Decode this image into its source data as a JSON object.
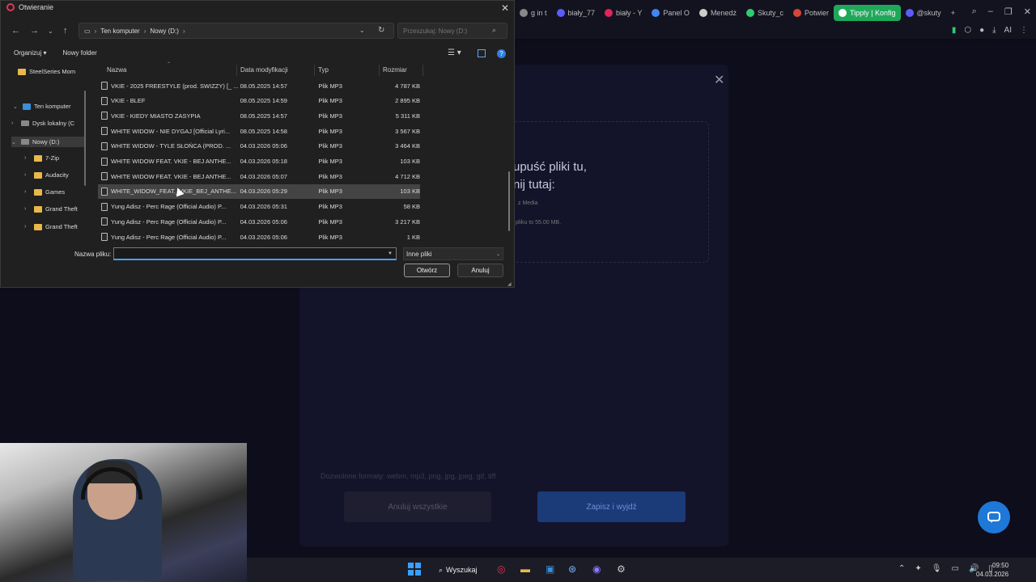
{
  "browser": {
    "tabs": [
      {
        "label": "g in t",
        "color": "#888888"
      },
      {
        "label": "biały_77",
        "color": "#5c5cff"
      },
      {
        "label": "biały - Y",
        "color": "#e0245e"
      },
      {
        "label": "Panel O",
        "color": "#4285f4"
      },
      {
        "label": "Menedż",
        "color": "#cccccc"
      },
      {
        "label": "Skuty_c",
        "color": "#2ecc71"
      },
      {
        "label": "Potwier",
        "color": "#d44638"
      },
      {
        "label": "Tipply | Konfig",
        "color": "#ffffff"
      },
      {
        "label": "@skuty",
        "color": "#5c5cff"
      }
    ],
    "active_tab_index": 7,
    "new_tab": "+",
    "ext_label": "AI"
  },
  "background_page": {
    "drop_text": "upuść pliki tu,\nnij tutaj:",
    "drop_sub": "z Media",
    "drop_size": "pliku to 55.00 MB.",
    "allowed_formats": "Dozwolone formaty: webm, mp3, png, jpg, jpeg, gif, tiff",
    "cancel_all_label": "Anuluj wszystkie",
    "save_label": "Zapisz i wyjdź"
  },
  "taskbar": {
    "search_label": "Wyszukaj",
    "time": "09:50",
    "date": "04.03.2026"
  },
  "dialog": {
    "title": "Otwieranie",
    "address": {
      "root": "Ten komputer",
      "current": "Nowy (D:)"
    },
    "search_placeholder": "Przeszukaj: Nowy (D:)",
    "toolbar": {
      "organize": "Organizuj",
      "new_folder": "Nowy folder"
    },
    "nav": [
      {
        "label": "SteelSeries Mom",
        "icon": "folder-icon",
        "level": 0
      },
      {
        "label": "Ten komputer",
        "icon": "pc-icon",
        "level": 0
      },
      {
        "label": "Dysk lokalny (C",
        "icon": "drive-icon",
        "level": 1
      },
      {
        "label": "Nowy (D:)",
        "icon": "drive-icon",
        "level": 1
      },
      {
        "label": "7-Zip",
        "icon": "folder-icon",
        "level": 2
      },
      {
        "label": "Audacity",
        "icon": "folder-icon",
        "level": 2
      },
      {
        "label": "Games",
        "icon": "folder-icon",
        "level": 2
      },
      {
        "label": "Grand Theft",
        "icon": "folder-icon",
        "level": 2
      },
      {
        "label": "Grand Theft",
        "icon": "folder-icon",
        "level": 2
      }
    ],
    "columns": {
      "name": "Nazwa",
      "date": "Data modyfikacji",
      "type": "Typ",
      "size": "Rozmiar"
    },
    "files": [
      {
        "name": "VKIE - 2025 FREESTYLE (prod. SWIZZY) [_ ...",
        "date": "08.05.2025 14:57",
        "type": "Plik MP3",
        "size": "4 787 KB"
      },
      {
        "name": "VKIE - BLEF",
        "date": "08.05.2025 14:59",
        "type": "Plik MP3",
        "size": "2 895 KB"
      },
      {
        "name": "VKIE - KIEDY MIASTO ZASYPIA",
        "date": "08.05.2025 14:57",
        "type": "Plik MP3",
        "size": "5 311 KB"
      },
      {
        "name": "WHITE WIDOW - NIE DYGAJ [Official Lyri...",
        "date": "08.05.2025 14:58",
        "type": "Plik MP3",
        "size": "3 567 KB"
      },
      {
        "name": "WHITE WIDOW - TYLE SŁOŃCA (PROD. ...",
        "date": "04.03.2026 05:06",
        "type": "Plik MP3",
        "size": "3 464 KB"
      },
      {
        "name": "WHITE WIDOW FEAT. VKIE - BEJ ANTHE...",
        "date": "04.03.2026 05:18",
        "type": "Plik MP3",
        "size": "103 KB"
      },
      {
        "name": "WHITE WIDOW FEAT. VKIE - BEJ ANTHE...",
        "date": "04.03.2026 05:07",
        "type": "Plik MP3",
        "size": "4 712 KB"
      },
      {
        "name": "WHITE_WIDOW_FEAT._VKIE_BEJ_ANTHE...",
        "date": "04.03.2026 05:29",
        "type": "Plik MP3",
        "size": "103 KB"
      },
      {
        "name": "Yung Adisz - Perc Rage (Official Audio) P...",
        "date": "04.03.2026 05:31",
        "type": "Plik MP3",
        "size": "58 KB"
      },
      {
        "name": "Yung Adisz - Perc Rage (Official Audio) P...",
        "date": "04.03.2026 05:06",
        "type": "Plik MP3",
        "size": "3 217 KB"
      },
      {
        "name": "Yung Adisz - Perc Rage (Official Audio) P...",
        "date": "04.03.2026 05:06",
        "type": "Plik MP3",
        "size": "1 KB"
      }
    ],
    "selected_index": 7,
    "filename_label": "Nazwa pliku:",
    "filename_value": "",
    "filetype": "Inne pliki",
    "open_label": "Otwórz",
    "cancel_label": "Anuluj"
  }
}
